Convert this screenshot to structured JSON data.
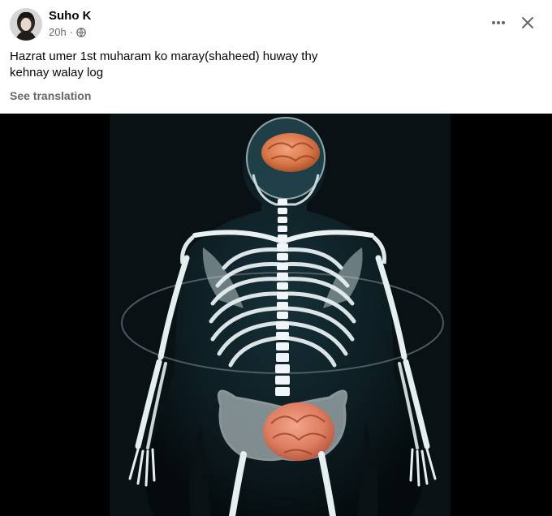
{
  "post": {
    "author": "Suho K",
    "time": "20h",
    "separator": "·",
    "privacy_icon": "globe-icon",
    "text_line_1": "Hazrat umer 1st muharam ko maray(shaheed) huway thy",
    "text_line_2": "kehnay walay log",
    "see_translation": "See translation",
    "more_label": "•••",
    "close_label": "✕",
    "media_icon": "skeleton-image"
  },
  "colors": {
    "text_primary": "#050505",
    "text_secondary": "#65676b",
    "media_background": "#000000",
    "brain": "#d9774a"
  }
}
